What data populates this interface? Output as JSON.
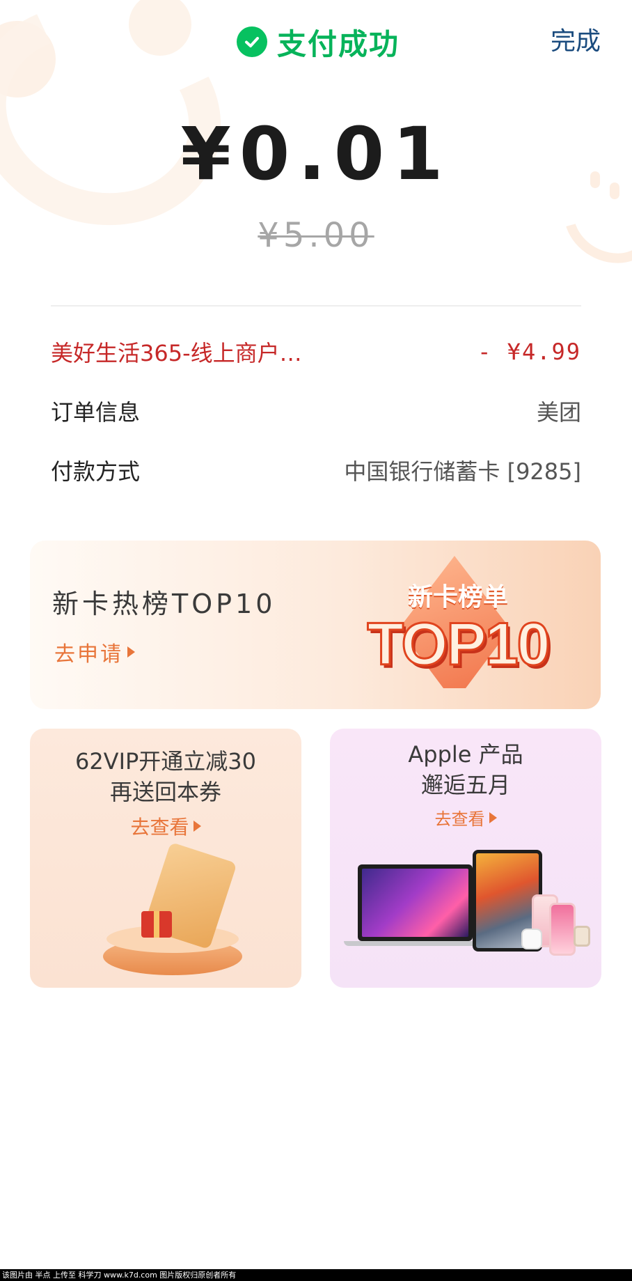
{
  "header": {
    "status_text": "支付成功",
    "done_label": "完成"
  },
  "payment": {
    "amount": "¥0.01",
    "original_amount": "¥5.00"
  },
  "details": {
    "discount": {
      "label": "美好生活365-线上商户…",
      "value": "- ¥4.99"
    },
    "order": {
      "label": "订单信息",
      "value": "美团"
    },
    "method": {
      "label": "付款方式",
      "value": "中国银行储蓄卡 [9285]"
    }
  },
  "banner": {
    "title": "新卡热榜TOP10",
    "cta": "去申请",
    "art_sub": "新卡榜单",
    "art_big": "TOP10"
  },
  "cards": [
    {
      "line1": "62VIP开通立减30",
      "line2": "再送回本券",
      "cta": "去查看"
    },
    {
      "line1": "Apple 产品",
      "line2": "邂逅五月",
      "cta": "去查看"
    }
  ],
  "watermark": "该图片由 半点 上传至 科学刀 www.k7d.com 图片版权归原创者所有",
  "colors": {
    "success_green": "#07c160",
    "discount_red": "#c62828",
    "cta_orange": "#e8753a",
    "done_blue": "#1a4b7e"
  },
  "icons": {
    "status": "check-circle-icon",
    "cta_arrow": "triangle-right-icon"
  }
}
